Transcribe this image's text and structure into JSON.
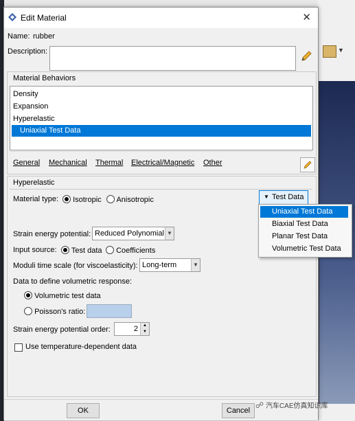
{
  "dialog": {
    "title": "Edit Material",
    "name_label": "Name:",
    "name_value": "rubber",
    "description_label": "Description:",
    "description_value": ""
  },
  "behaviors": {
    "group_label": "Material Behaviors",
    "items": [
      "Density",
      "Expansion",
      "Hyperelastic",
      "Uniaxial Test Data"
    ],
    "selected_index": 3
  },
  "menu": {
    "items": [
      "General",
      "Mechanical",
      "Thermal",
      "Electrical/Magnetic",
      "Other"
    ]
  },
  "hyperelastic": {
    "section_label": "Hyperelastic",
    "material_type_label": "Material type:",
    "isotropic_label": "Isotropic",
    "anisotropic_label": "Anisotropic",
    "test_data_button": "Test Data",
    "test_data_options": [
      "Uniaxial Test Data",
      "Biaxial Test Data",
      "Planar Test Data",
      "Volumetric Test Data"
    ],
    "test_data_highlighted": 0,
    "strain_energy_label": "Strain energy potential:",
    "strain_energy_value": "Reduced Polynomial",
    "input_source_label": "Input source:",
    "input_test_data_label": "Test data",
    "input_coefficients_label": "Coefficients",
    "moduli_label": "Moduli time scale (for viscoelasticity):",
    "moduli_value": "Long-term",
    "volumetric_header": "Data to define volumetric response:",
    "volumetric_test_data_label": "Volumetric test data",
    "poisson_label": "Poisson's ratio:",
    "poisson_value": "",
    "order_label": "Strain energy potential order:",
    "order_value": "2",
    "temp_dependent_label": "Use temperature-dependent data"
  },
  "footer": {
    "ok_label": "OK",
    "cancel_label": "Cancel"
  },
  "watermark": "汽车CAE仿真知识库",
  "colors": {
    "selection": "#0078d7",
    "poisson_field": "#b8d0ec"
  }
}
